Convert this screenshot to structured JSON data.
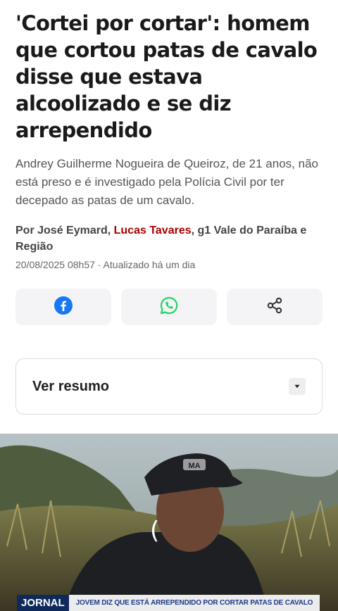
{
  "article": {
    "title": "'Cortei por cortar': homem que cortou patas de cavalo disse que estava alcoolizado e se diz arrependido",
    "subtitle": "Andrey Guilherme Nogueira de Queiroz, de 21 anos, não está preso e é investigado pela Polícia Civil por ter decepado as patas de um cavalo.",
    "byline_prefix": "Por José Eymard, ",
    "byline_link": "Lucas Tavares",
    "byline_suffix": ", g1 Vale do Paraíba e Região",
    "date": "20/08/2025 08h57",
    "updated": " · Atualizado há um dia"
  },
  "share": {
    "buttons": [
      {
        "icon": "facebook-icon",
        "color": "#1877F2"
      },
      {
        "icon": "whatsapp-icon",
        "color": "#25D366"
      },
      {
        "icon": "share-icon",
        "color": "#333333"
      }
    ]
  },
  "summary": {
    "label": "Ver resumo",
    "icon": "caret-down-icon"
  },
  "video": {
    "channel_tag": "JORNAL",
    "headline": "JOVEM DIZ QUE ESTÁ ARREPENDIDO POR CORTAR PATAS DE CAVALO",
    "cap_text": "MA",
    "loading_icon": "loading-spinner-icon"
  },
  "colors": {
    "link": "#a80000",
    "tag_bg": "#0f2a5a",
    "strip_text": "#1a3b8a"
  }
}
